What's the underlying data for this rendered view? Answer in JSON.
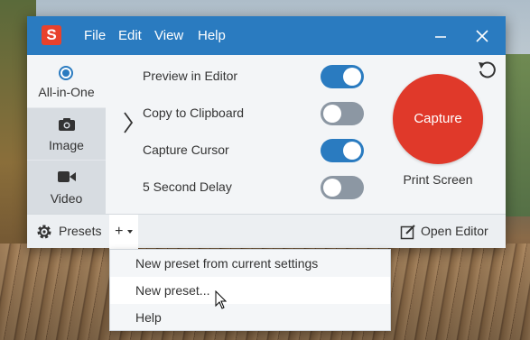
{
  "titlebar": {
    "logo_letter": "S",
    "menus": [
      "File",
      "Edit",
      "View",
      "Help"
    ]
  },
  "sidebar": {
    "items": [
      {
        "label": "All-in-One",
        "icon": "radio-selected-icon"
      },
      {
        "label": "Image",
        "icon": "camera-icon"
      },
      {
        "label": "Video",
        "icon": "video-camera-icon"
      }
    ]
  },
  "options": [
    {
      "label": "Preview in Editor",
      "enabled": true
    },
    {
      "label": "Copy to Clipboard",
      "enabled": false
    },
    {
      "label": "Capture Cursor",
      "enabled": true
    },
    {
      "label": "5 Second Delay",
      "enabled": false
    }
  ],
  "capture": {
    "button_label": "Capture",
    "hotkey_label": "Print Screen"
  },
  "bottombar": {
    "presets_label": "Presets",
    "add_label": "+",
    "open_editor_label": "Open Editor"
  },
  "dropdown": {
    "items": [
      "New preset from current settings",
      "New preset...",
      "Help"
    ]
  },
  "colors": {
    "accent": "#2a7bc0",
    "capture": "#e0392a",
    "logo": "#e8412c"
  }
}
